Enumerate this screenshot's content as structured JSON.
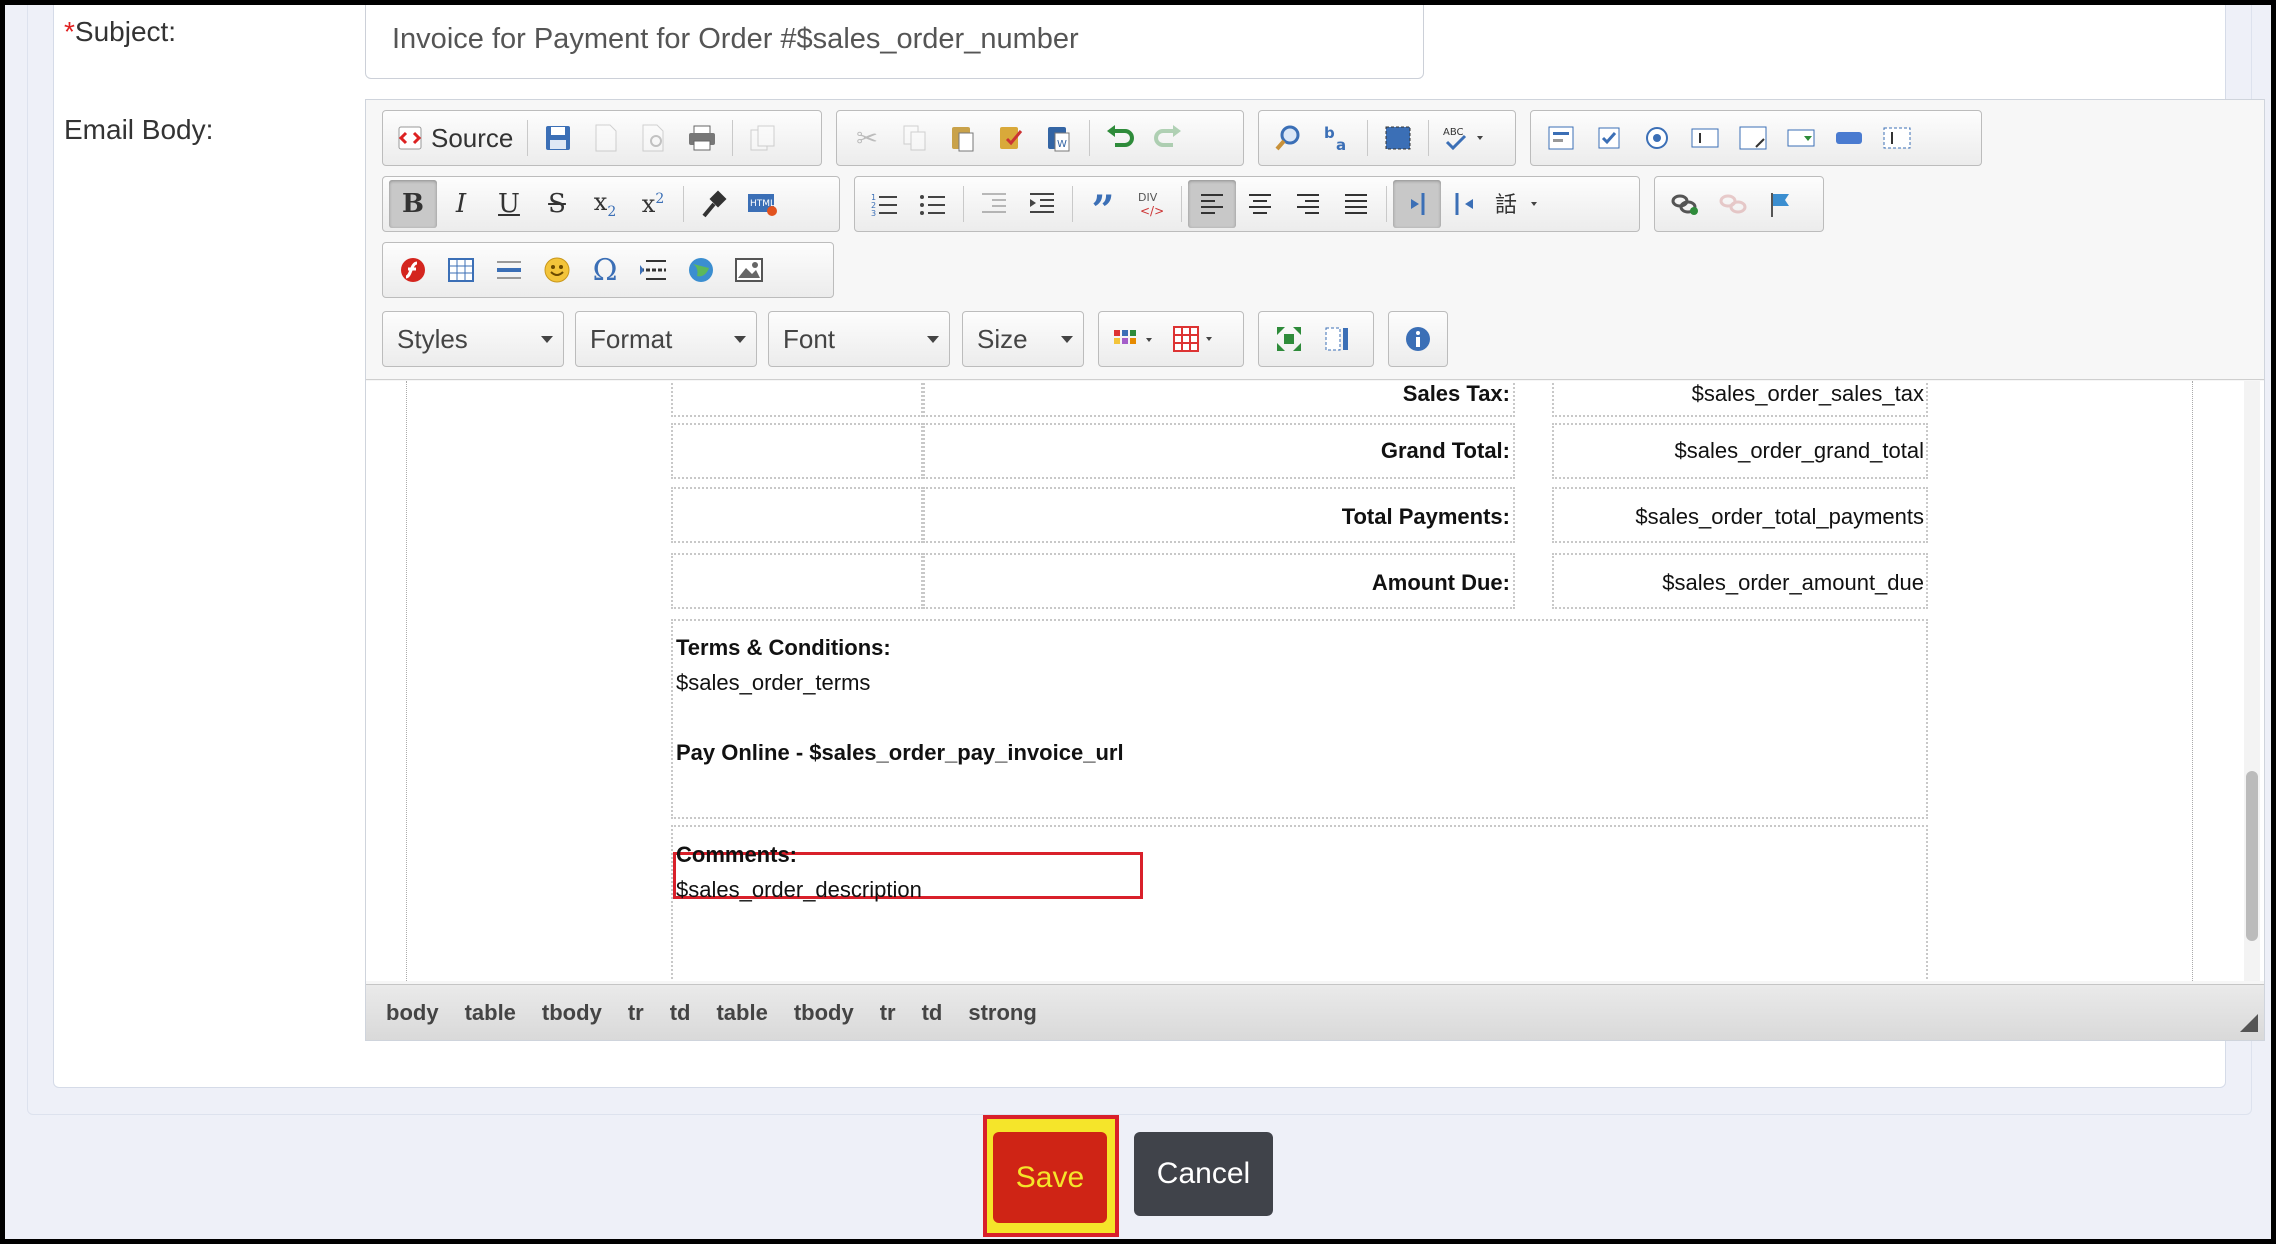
{
  "form": {
    "subject_required_mark": "*",
    "subject_label": "Subject:",
    "subject_value": "Invoice for Payment for Order #$sales_order_number",
    "email_body_label": "Email Body:"
  },
  "toolbar": {
    "source_label": "Source",
    "styles_label": "Styles",
    "format_label": "Format",
    "font_label": "Font",
    "size_label": "Size"
  },
  "content": {
    "rows": [
      {
        "label": "Sales Tax:",
        "value": "$sales_order_sales_tax"
      },
      {
        "label": "Grand Total:",
        "value": "$sales_order_grand_total"
      },
      {
        "label": "Total Payments:",
        "value": "$sales_order_total_payments"
      },
      {
        "label": "Amount Due:",
        "value": "$sales_order_amount_due"
      }
    ],
    "terms_heading": "Terms & Conditions:",
    "terms_value": "$sales_order_terms",
    "pay_online": "Pay Online - $sales_order_pay_invoice_url",
    "comments_heading": "Comments:",
    "comments_value": "$sales_order_description"
  },
  "path_bar": [
    "body",
    "table",
    "tbody",
    "tr",
    "td",
    "table",
    "tbody",
    "tr",
    "td",
    "strong"
  ],
  "actions": {
    "save_label": "Save",
    "cancel_label": "Cancel"
  },
  "colors": {
    "save_bg": "#cf2415",
    "save_text": "#f5e52a",
    "highlight": "#d9202a",
    "cancel_bg": "#40434a"
  }
}
